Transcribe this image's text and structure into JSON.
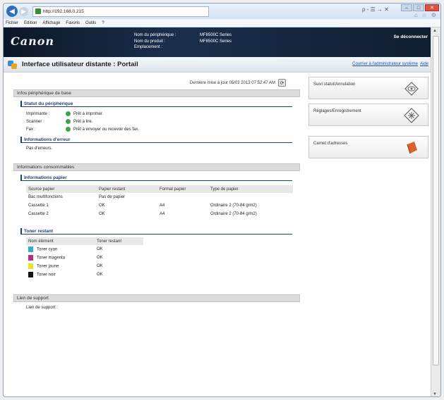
{
  "browser": {
    "url": "http://192.168.0.215",
    "menu": [
      "Fichier",
      "Edition",
      "Affichage",
      "Favoris",
      "Outils",
      "?"
    ],
    "search_hint": "ρ - ☰ → ✕"
  },
  "banner": {
    "logo": "Canon",
    "device_name_label": "Nom du périphérique :",
    "device_name_value": "MF8500C Series",
    "product_name_label": "Nom du produit :",
    "product_name_value": "MF8500C Series",
    "location_label": "Emplacement :",
    "location_value": "",
    "logout": "Se déconnecter"
  },
  "header": {
    "title": "Interface utilisateur distante : Portail",
    "contact_link": "Courrier à l'administrateur système",
    "help_link": "Aide"
  },
  "last_update": "Dernière mise à jour 05/03 2013 07 52:47 AM",
  "basic_info": {
    "section": "Infos périphérique de base",
    "status_title": "Statut du périphérique",
    "status": [
      {
        "label": "Imprimante :",
        "value": "Prêt à imprimer."
      },
      {
        "label": "Scanner :",
        "value": "Prêt à lire."
      },
      {
        "label": "Fax :",
        "value": "Prêt à envoyer ou recevoir des fax."
      }
    ],
    "error_title": "Informations d'erreur",
    "error_text": "Pas d'erreurs."
  },
  "consumables": {
    "section": "Informations consommables",
    "paper_title": "Informations papier",
    "paper_headers": [
      "Source papier",
      "Papier restant",
      "Format papier",
      "Type de papier"
    ],
    "paper_rows": [
      [
        "Bac multifonctions",
        "Pas de papier",
        "",
        ""
      ],
      [
        "Cassette 1",
        "OK",
        "A4",
        "Ordinaire 2 (70-84 g/m2)"
      ],
      [
        "Cassette 2",
        "OK",
        "A4",
        "Ordinaire 2 (70-84 g/m2)"
      ]
    ],
    "toner_title": "Toner restant",
    "toner_headers": [
      "Nom élément",
      "Toner restant"
    ],
    "toner_rows": [
      {
        "name": "Toner cyan",
        "status": "OK",
        "color": "#2bb3c6"
      },
      {
        "name": "Toner magenta",
        "status": "OK",
        "color": "#b5318f"
      },
      {
        "name": "Toner jaune",
        "status": "OK",
        "color": "#e8e22a"
      },
      {
        "name": "Toner noir",
        "status": "OK",
        "color": "#111111"
      }
    ]
  },
  "support": {
    "section": "Lien de support",
    "label": "Lien de support :"
  },
  "side_menu": [
    {
      "label": "Suivi statut/Annulation",
      "icon": "monitor-icon"
    },
    {
      "label": "Réglages/Enregistrement",
      "icon": "settings-icon"
    },
    {
      "label": "Carnet d'adresses",
      "icon": "address-book-icon"
    }
  ]
}
